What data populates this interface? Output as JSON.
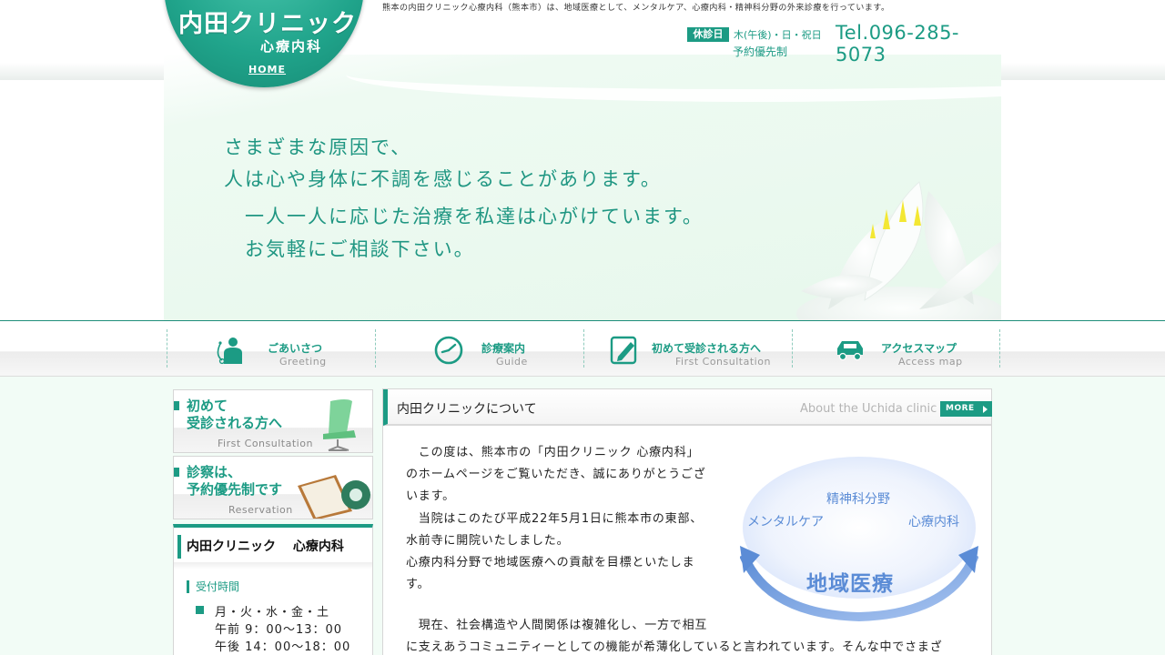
{
  "header": {
    "logo_title": "内田クリニック",
    "logo_subtitle": "心療内科",
    "home_link": "HOME",
    "intro": "熊本の内田クリニック心療内科（熊本市）は、地域医療として、メンタルケア、心療内科・精神科分野の外来診療を行っています。",
    "closed_label": "休診日",
    "closed_days": "木(午後)・日・祝日",
    "reservation_note": "予約優先制",
    "tel": "Tel.096-285-5073"
  },
  "hero": {
    "line1": "さまざまな原因で、",
    "line2": "人は心や身体に不調を感じることがあります。",
    "line3": "一人一人に応じた治療を私達は心がけています。",
    "line4": "お気軽にご相談下さい。"
  },
  "nav": [
    {
      "jp": "ごあいさつ",
      "en": "Greeting",
      "icon": "doctor-icon"
    },
    {
      "jp": "診療案内",
      "en": "Guide",
      "icon": "clock-icon"
    },
    {
      "jp": "初めて受診される方へ",
      "en": "First Consultation",
      "icon": "pencil-note-icon"
    },
    {
      "jp": "アクセスマップ",
      "en": "Access map",
      "icon": "car-icon"
    }
  ],
  "sidebar": {
    "banner1": {
      "line1": "初めて",
      "line2": "受診される方へ",
      "en": "First Consultation"
    },
    "banner2": {
      "line1": "診察は、",
      "line2": "予約優先制です",
      "en": "Reservation"
    },
    "clinic_box": {
      "title": "内田クリニック　 心療内科",
      "hours_label": "受付時間",
      "days": "月・火・水・金・土",
      "am": "午前 9：00〜13：00",
      "pm": "午後 14：00〜18：00"
    }
  },
  "main": {
    "title": "内田クリニックについて",
    "en_title": "About the Uchida clinic",
    "more": "MORE",
    "p1_lines": [
      "　この度は、熊本市の「内田クリニック 心療内科」",
      "のホームページをご覧いただき、誠にありがとうござ",
      "います。",
      "　当院はこのたび平成22年5月1日に熊本市の東部、",
      "水前寺に開院いたしました。",
      "心療内科分野で地域医療への貢献を目標といたしま",
      "す。"
    ],
    "p2_lines": [
      "　現在、社会構造や人間関係は複雑化し、一方で相互",
      "に支えあうコミュニティーとしての機能が希薄化していると言われています。そんな中でさまざ"
    ],
    "diagram": {
      "top": "精神科分野",
      "left": "メンタルケア",
      "right": "心療内科",
      "center": "地域医療"
    }
  },
  "colors": {
    "accent": "#1c9b84",
    "diagram_blue": "#5b8cd6"
  }
}
